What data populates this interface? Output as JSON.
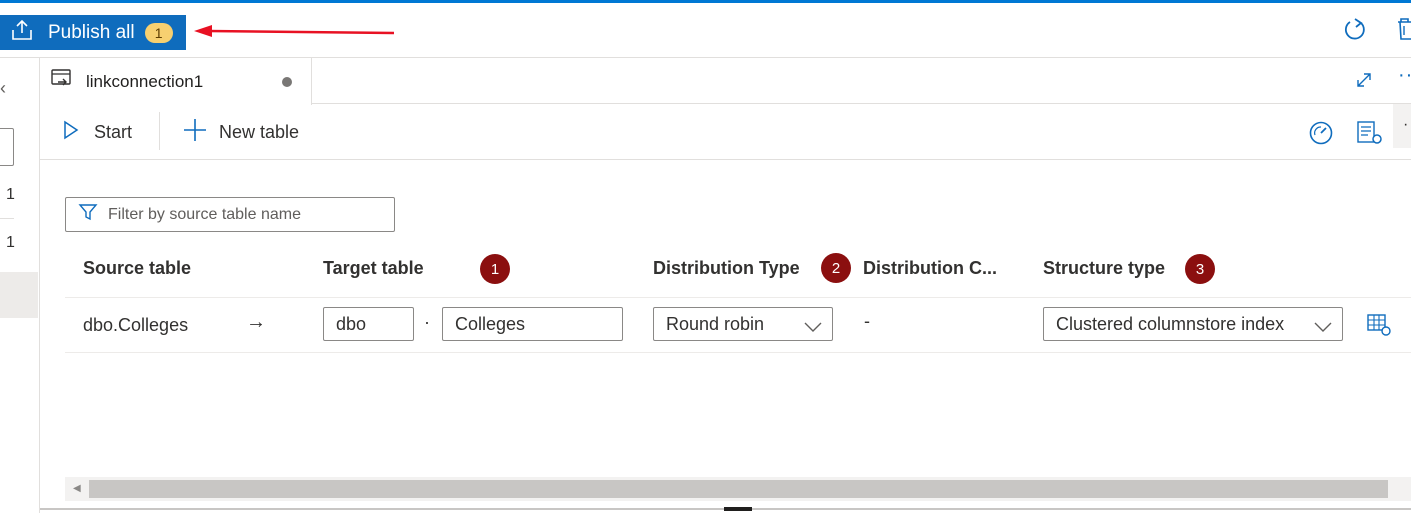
{
  "topbar": {
    "publish_label": "Publish all",
    "publish_count": "1",
    "accent": "#0f6cbd"
  },
  "leftpane": {
    "chevron": "‹",
    "rows": [
      "1",
      "1"
    ]
  },
  "tab": {
    "title": "linkconnection1",
    "icon": "link-connection-icon"
  },
  "toolbar": {
    "start_label": "Start",
    "new_table_label": "New table",
    "more": "·"
  },
  "filter": {
    "placeholder": "Filter by source table name",
    "value": ""
  },
  "table": {
    "headers": {
      "source": "Source table",
      "target": "Target table",
      "distribution_type": "Distribution Type",
      "distribution_column": "Distribution C...",
      "structure_type": "Structure type"
    },
    "badges": [
      "1",
      "2",
      "3"
    ],
    "badge_color": "#8b0f0f",
    "rows": [
      {
        "source": "dbo.Colleges",
        "arrow": "→",
        "target_schema": "dbo",
        "dot": "·",
        "target_table": "Colleges",
        "distribution_type": "Round robin",
        "distribution_column": "-",
        "structure_type": "Clustered columnstore index"
      }
    ]
  },
  "colors": {
    "annotation_arrow": "#e81123",
    "badge_yellow": "#f7d070"
  }
}
